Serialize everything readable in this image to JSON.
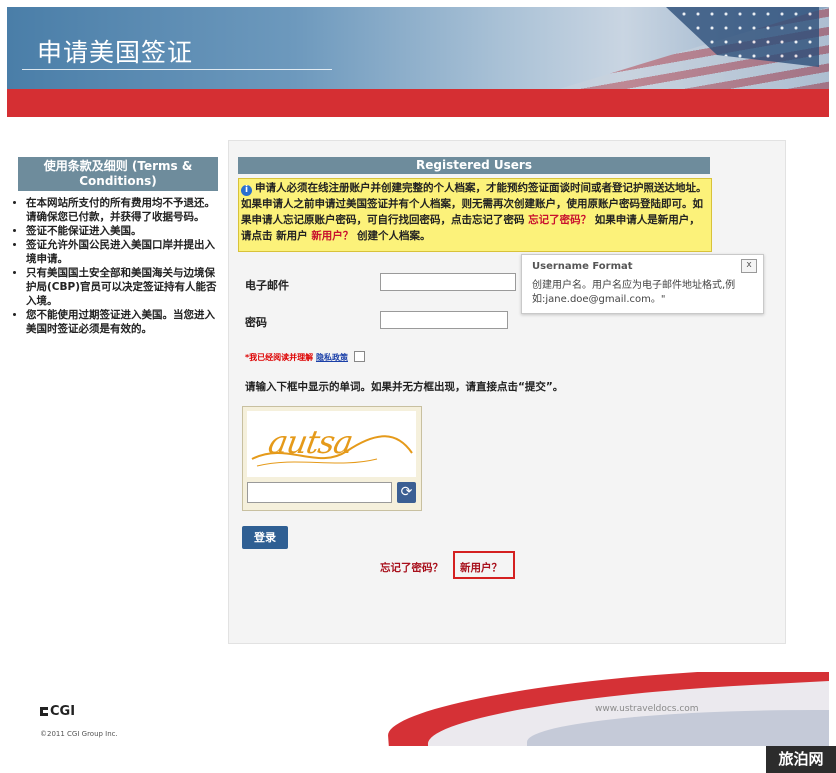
{
  "header": {
    "title": "申请美国签证"
  },
  "sidebar": {
    "heading": "使用条款及细则 (Terms & Conditions)",
    "items": [
      "在本网站所支付的所有费用均不予退还。请确保您已付款，并获得了收据号码。",
      "签证不能保证进入美国。",
      "签证允许外国公民进入美国口岸并提出入境申请。",
      "只有美国国土安全部和美国海关与边境保护局(CBP)官员可以决定签证持有人能否入境。",
      "您不能使用过期签证进入美国。当您进入美国时签证必须是有效的。"
    ]
  },
  "main": {
    "registered_users": "Registered Users",
    "notice": {
      "text_part1": "申请人必须在线注册账户并创建完整的个人档案，才能预约签证面谈时间或者登记护照送达地址。如果申请人之前申请过美国签证并有个人档案，则无需再次创建账户，使用原账户密码登陆即可。如果申请人忘记原账户密码，可自行找回密码，点击忘记了密码 ",
      "forgot_link": "忘记了密码？",
      "text_part2": " 如果申请人是新用户，请点击 新用户 ",
      "new_user_link": "新用户？",
      "text_part3": " 创建个人档案。"
    },
    "email_label": "电子邮件",
    "password_label": "密码",
    "agree_text": "*我已经阅读并理解",
    "privacy_link": "隐私政策",
    "captcha_prompt": "请输入下框中显示的单词。如果并无方框出现，请直接点击“提交”。",
    "captcha_word": "autsa",
    "login_button": "登录",
    "forgot_password": "忘记了密码？",
    "new_user": "新用户？"
  },
  "tooltip": {
    "title": "Username Format",
    "close": "x",
    "body": "创建用户名。用户名应为电子邮件地址格式,例如:jane.doe@gmail.com。\""
  },
  "footer": {
    "site": "www.ustraveldocs.com",
    "logo": "CGI",
    "copyright": "©2011 CGI Group Inc."
  },
  "watermark": "旅泊网",
  "colors": {
    "red_bar": "#d52f33",
    "section_head": "#6e8c9c",
    "notice_bg": "#fcf27a",
    "button": "#2f5f93"
  }
}
